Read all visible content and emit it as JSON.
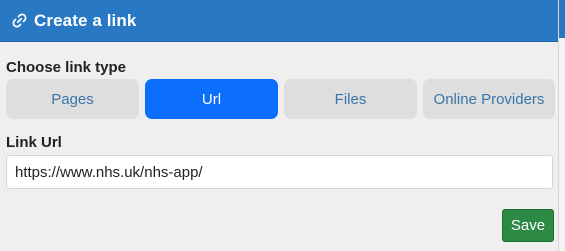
{
  "header": {
    "title": "Create a link",
    "icon": "link-icon"
  },
  "link_type": {
    "label": "Choose link type",
    "options": [
      "Pages",
      "Url",
      "Files",
      "Online Providers"
    ],
    "selected": "Url"
  },
  "link_url": {
    "label": "Link Url",
    "value": "https://www.nhs.uk/nhs-app/"
  },
  "actions": {
    "save_label": "Save"
  },
  "colors": {
    "header": "#2878c3",
    "active_button": "#0b6efd",
    "inactive_button": "#dedede",
    "inactive_text": "#3b75a9",
    "save_button": "#2d8a45"
  }
}
